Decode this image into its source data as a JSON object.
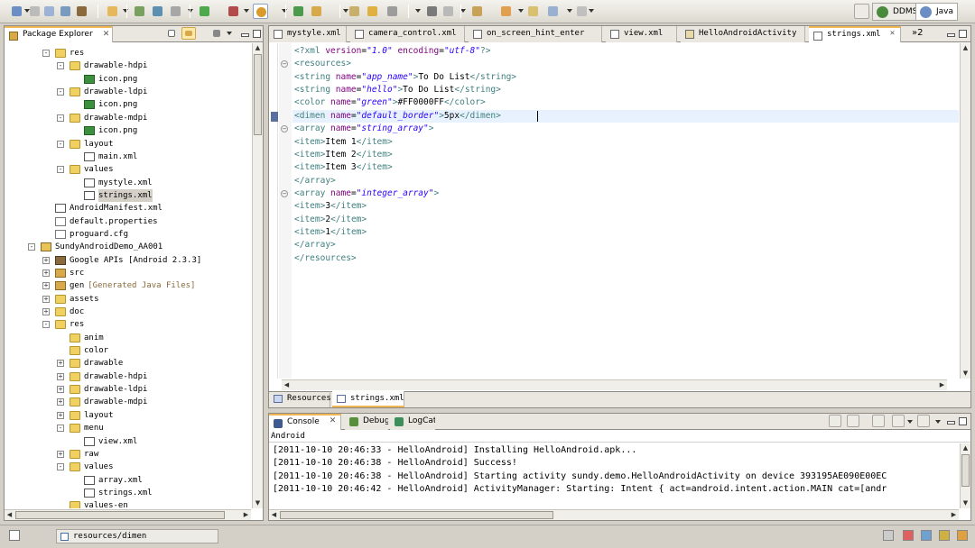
{
  "perspectives": [
    {
      "label": "DDMS"
    },
    {
      "label": "Java"
    }
  ],
  "explorer": {
    "title": "Package Explorer",
    "rows": [
      {
        "label": "res",
        "indent": 1,
        "icon": "folder",
        "exp": "-"
      },
      {
        "label": "drawable-hdpi",
        "indent": 2,
        "icon": "folder",
        "exp": "-"
      },
      {
        "label": "icon.png",
        "indent": 3,
        "icon": "png",
        "exp": ""
      },
      {
        "label": "drawable-ldpi",
        "indent": 2,
        "icon": "folder",
        "exp": "-"
      },
      {
        "label": "icon.png",
        "indent": 3,
        "icon": "png",
        "exp": ""
      },
      {
        "label": "drawable-mdpi",
        "indent": 2,
        "icon": "folder",
        "exp": "-"
      },
      {
        "label": "icon.png",
        "indent": 3,
        "icon": "png",
        "exp": ""
      },
      {
        "label": "layout",
        "indent": 2,
        "icon": "folder",
        "exp": "-"
      },
      {
        "label": "main.xml",
        "indent": 3,
        "icon": "xml",
        "exp": ""
      },
      {
        "label": "values",
        "indent": 2,
        "icon": "folder",
        "exp": "-"
      },
      {
        "label": "mystyle.xml",
        "indent": 3,
        "icon": "xml",
        "exp": ""
      },
      {
        "label": "strings.xml",
        "indent": 3,
        "icon": "xml",
        "exp": "",
        "selected": true
      },
      {
        "label": "AndroidManifest.xml",
        "indent": 1,
        "icon": "xml",
        "exp": ""
      },
      {
        "label": "default.properties",
        "indent": 1,
        "icon": "file",
        "exp": ""
      },
      {
        "label": "proguard.cfg",
        "indent": 1,
        "icon": "file",
        "exp": ""
      },
      {
        "label": "SundyAndroidDemo_AA001",
        "indent": 0,
        "icon": "proj",
        "exp": "-"
      },
      {
        "label": "Google APIs [Android 2.3.3]",
        "indent": 1,
        "icon": "lib",
        "exp": "+"
      },
      {
        "label": "src",
        "indent": 1,
        "icon": "pkg",
        "exp": "+"
      },
      {
        "label": "gen",
        "extra": "[Generated Java Files]",
        "indent": 1,
        "icon": "pkg",
        "exp": "+"
      },
      {
        "label": "assets",
        "indent": 1,
        "icon": "folder",
        "exp": "+"
      },
      {
        "label": "doc",
        "indent": 1,
        "icon": "folder",
        "exp": "+"
      },
      {
        "label": "res",
        "indent": 1,
        "icon": "folder",
        "exp": "-"
      },
      {
        "label": "anim",
        "indent": 2,
        "icon": "folder",
        "exp": ""
      },
      {
        "label": "color",
        "indent": 2,
        "icon": "folder",
        "exp": ""
      },
      {
        "label": "drawable",
        "indent": 2,
        "icon": "folder",
        "exp": "+"
      },
      {
        "label": "drawable-hdpi",
        "indent": 2,
        "icon": "folder",
        "exp": "+"
      },
      {
        "label": "drawable-ldpi",
        "indent": 2,
        "icon": "folder",
        "exp": "+"
      },
      {
        "label": "drawable-mdpi",
        "indent": 2,
        "icon": "folder",
        "exp": "+"
      },
      {
        "label": "layout",
        "indent": 2,
        "icon": "folder",
        "exp": "+"
      },
      {
        "label": "menu",
        "indent": 2,
        "icon": "folder",
        "exp": "-"
      },
      {
        "label": "view.xml",
        "indent": 3,
        "icon": "xml",
        "exp": ""
      },
      {
        "label": "raw",
        "indent": 2,
        "icon": "folder",
        "exp": "+"
      },
      {
        "label": "values",
        "indent": 2,
        "icon": "folder",
        "exp": "-"
      },
      {
        "label": "array.xml",
        "indent": 3,
        "icon": "xml",
        "exp": ""
      },
      {
        "label": "strings.xml",
        "indent": 3,
        "icon": "xml",
        "exp": ""
      },
      {
        "label": "values-en",
        "indent": 2,
        "icon": "folder",
        "exp": ""
      }
    ]
  },
  "editor": {
    "tabs": [
      {
        "label": "mystyle.xml",
        "icon": "xml"
      },
      {
        "label": "camera_control.xml",
        "icon": "xml"
      },
      {
        "label": "on_screen_hint_enter",
        "icon": "xml"
      },
      {
        "label": "view.xml",
        "icon": "xml"
      },
      {
        "label": "HelloAndroidActivity",
        "icon": "java"
      },
      {
        "label": "strings.xml",
        "icon": "xml",
        "active": true
      }
    ],
    "overflow": "»2",
    "lines": [
      [
        {
          "c": "t-pi",
          "t": "<?xml "
        },
        {
          "c": "t-attr",
          "t": "version"
        },
        {
          "c": "t-text",
          "t": "="
        },
        {
          "c": "t-val",
          "t": "\"1.0\""
        },
        {
          "c": "t-text",
          "t": " "
        },
        {
          "c": "t-attr",
          "t": "encoding"
        },
        {
          "c": "t-text",
          "t": "="
        },
        {
          "c": "t-val",
          "t": "\"utf-8\""
        },
        {
          "c": "t-pi",
          "t": "?>"
        }
      ],
      [
        {
          "c": "t-tag",
          "t": "<resources>"
        }
      ],
      [
        {
          "c": "t-tag",
          "t": "<string "
        },
        {
          "c": "t-attr",
          "t": "name"
        },
        {
          "c": "t-text",
          "t": "="
        },
        {
          "c": "t-val",
          "t": "\"app_name\""
        },
        {
          "c": "t-tag",
          "t": ">"
        },
        {
          "c": "t-text",
          "t": "To Do List"
        },
        {
          "c": "t-tag",
          "t": "</string>"
        }
      ],
      [
        {
          "c": "t-tag",
          "t": "<string "
        },
        {
          "c": "t-attr",
          "t": "name"
        },
        {
          "c": "t-text",
          "t": "="
        },
        {
          "c": "t-val",
          "t": "\"hello\""
        },
        {
          "c": "t-tag",
          "t": ">"
        },
        {
          "c": "t-text",
          "t": "To Do List"
        },
        {
          "c": "t-tag",
          "t": "</string>"
        }
      ],
      [
        {
          "c": "t-tag",
          "t": "<color "
        },
        {
          "c": "t-attr",
          "t": "name"
        },
        {
          "c": "t-text",
          "t": "="
        },
        {
          "c": "t-val",
          "t": "\"green\""
        },
        {
          "c": "t-tag",
          "t": ">"
        },
        {
          "c": "t-text",
          "t": "#FF0000FF"
        },
        {
          "c": "t-tag",
          "t": "</color>"
        }
      ],
      [
        {
          "c": "t-tag",
          "t": "<dimen "
        },
        {
          "c": "t-attr",
          "t": "name"
        },
        {
          "c": "t-text",
          "t": "="
        },
        {
          "c": "t-val",
          "t": "\"default_border\""
        },
        {
          "c": "t-tag",
          "t": ">"
        },
        {
          "c": "t-text",
          "t": "5px"
        },
        {
          "c": "t-tag",
          "t": "</dimen>"
        }
      ],
      [
        {
          "c": "t-tag",
          "t": "<array "
        },
        {
          "c": "t-attr",
          "t": "name"
        },
        {
          "c": "t-text",
          "t": "="
        },
        {
          "c": "t-val",
          "t": "\"string_array\""
        },
        {
          "c": "t-tag",
          "t": ">"
        }
      ],
      [
        {
          "c": "t-tag",
          "t": "<item>"
        },
        {
          "c": "t-text",
          "t": "Item 1"
        },
        {
          "c": "t-tag",
          "t": "</item>"
        }
      ],
      [
        {
          "c": "t-tag",
          "t": "<item>"
        },
        {
          "c": "t-text",
          "t": "Item 2"
        },
        {
          "c": "t-tag",
          "t": "</item>"
        }
      ],
      [
        {
          "c": "t-tag",
          "t": "<item>"
        },
        {
          "c": "t-text",
          "t": "Item 3"
        },
        {
          "c": "t-tag",
          "t": "</item>"
        }
      ],
      [
        {
          "c": "t-tag",
          "t": "</array>"
        }
      ],
      [
        {
          "c": "t-tag",
          "t": "<array "
        },
        {
          "c": "t-attr",
          "t": "name"
        },
        {
          "c": "t-text",
          "t": "="
        },
        {
          "c": "t-val",
          "t": "\"integer_array\""
        },
        {
          "c": "t-tag",
          "t": ">"
        }
      ],
      [
        {
          "c": "t-tag",
          "t": "<item>"
        },
        {
          "c": "t-text",
          "t": "3"
        },
        {
          "c": "t-tag",
          "t": "</item>"
        }
      ],
      [
        {
          "c": "t-tag",
          "t": "<item>"
        },
        {
          "c": "t-text",
          "t": "2"
        },
        {
          "c": "t-tag",
          "t": "</item>"
        }
      ],
      [
        {
          "c": "t-tag",
          "t": "<item>"
        },
        {
          "c": "t-text",
          "t": "1"
        },
        {
          "c": "t-tag",
          "t": "</item>"
        }
      ],
      [
        {
          "c": "t-tag",
          "t": "</array>"
        }
      ],
      [
        {
          "c": "t-tag",
          "t": "</resources>"
        }
      ]
    ],
    "fold_lines": [
      1,
      6,
      11
    ],
    "current_line": 5,
    "bottom_tabs": [
      {
        "label": "Resources"
      },
      {
        "label": "strings.xml",
        "active": true
      }
    ]
  },
  "console": {
    "tabs": [
      {
        "label": "Console",
        "active": true
      },
      {
        "label": "Debug"
      },
      {
        "label": "LogCat"
      }
    ],
    "header": "Android",
    "lines": [
      "[2011-10-10 20:46:33 - HelloAndroid] Installing HelloAndroid.apk...",
      "[2011-10-10 20:46:38 - HelloAndroid] Success!",
      "[2011-10-10 20:46:38 - HelloAndroid] Starting activity sundy.demo.HelloAndroidActivity on device 393195AE090E00EC",
      "[2011-10-10 20:46:42 - HelloAndroid] ActivityManager: Starting: Intent { act=android.intent.action.MAIN cat=[andr"
    ]
  },
  "status": {
    "path": "resources/dimen"
  },
  "colors": {
    "tag": "#3f7f7f",
    "attr": "#7f007f",
    "value": "#2a00ff",
    "tab_accent": "#f0b654"
  }
}
